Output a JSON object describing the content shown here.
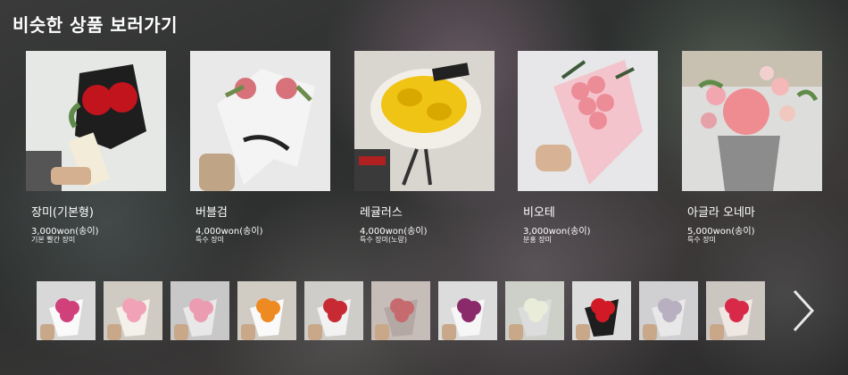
{
  "header": {
    "title": "비슷한 상품 보러가기"
  },
  "products": [
    {
      "name": "장미(기본형)",
      "price": "3,000won(송이)",
      "desc": "기본 빨간 장미",
      "bg": "#e6e8e6",
      "wrap": "#1e1e1e",
      "flower": "#c2141c"
    },
    {
      "name": "버블검",
      "price": "4,000won(송이)",
      "desc": "특수 장미",
      "bg": "#e9e9e9",
      "wrap": "#f4f4f4",
      "flower": "#d8727a"
    },
    {
      "name": "레귤러스",
      "price": "4,000won(송이)",
      "desc": "특수 장미(노랑)",
      "bg": "#d9d6cf",
      "wrap": "#f2efe8",
      "flower": "#f0c414"
    },
    {
      "name": "비오테",
      "price": "3,000won(송이)",
      "desc": "분홍 장미",
      "bg": "#e7e7e9",
      "wrap": "#f4c4cc",
      "flower": "#ec8c96"
    },
    {
      "name": "아글라 오네마",
      "price": "5,000won(송이)",
      "desc": "특수 장미",
      "bg": "#dddddb",
      "wrap": "#8c8c8c",
      "flower": "#ee8c92"
    }
  ],
  "thumbnails": [
    {
      "bg": "#d8d8d8",
      "flower": "#d0407a",
      "wrap": "#fafafa"
    },
    {
      "bg": "#cfcac2",
      "flower": "#f2a2b6",
      "wrap": "#f4f0ea"
    },
    {
      "bg": "#c8c8c8",
      "flower": "#ec9cb0",
      "wrap": "#e8e8e8"
    },
    {
      "bg": "#d0ccc4",
      "flower": "#ee8a22",
      "wrap": "#fafafa"
    },
    {
      "bg": "#cfcdc9",
      "flower": "#c82a34",
      "wrap": "#f2f2f2"
    },
    {
      "bg": "#c6bcb8",
      "flower": "#c66a6e",
      "wrap": "#b4a8a4"
    },
    {
      "bg": "#dcdcdc",
      "flower": "#8a2a6a",
      "wrap": "#f6f6f6"
    },
    {
      "bg": "#cdd0c8",
      "flower": "#e8ecd8",
      "wrap": "#dcdcdc"
    },
    {
      "bg": "#dcdcdc",
      "flower": "#d21a26",
      "wrap": "#1e1e1e"
    },
    {
      "bg": "#d0d0d2",
      "flower": "#b8b0c0",
      "wrap": "#e8e8e8"
    },
    {
      "bg": "#cbc6c0",
      "flower": "#d82a48",
      "wrap": "#efe8e2"
    }
  ],
  "icons": {
    "next": "chevron-right-icon"
  }
}
